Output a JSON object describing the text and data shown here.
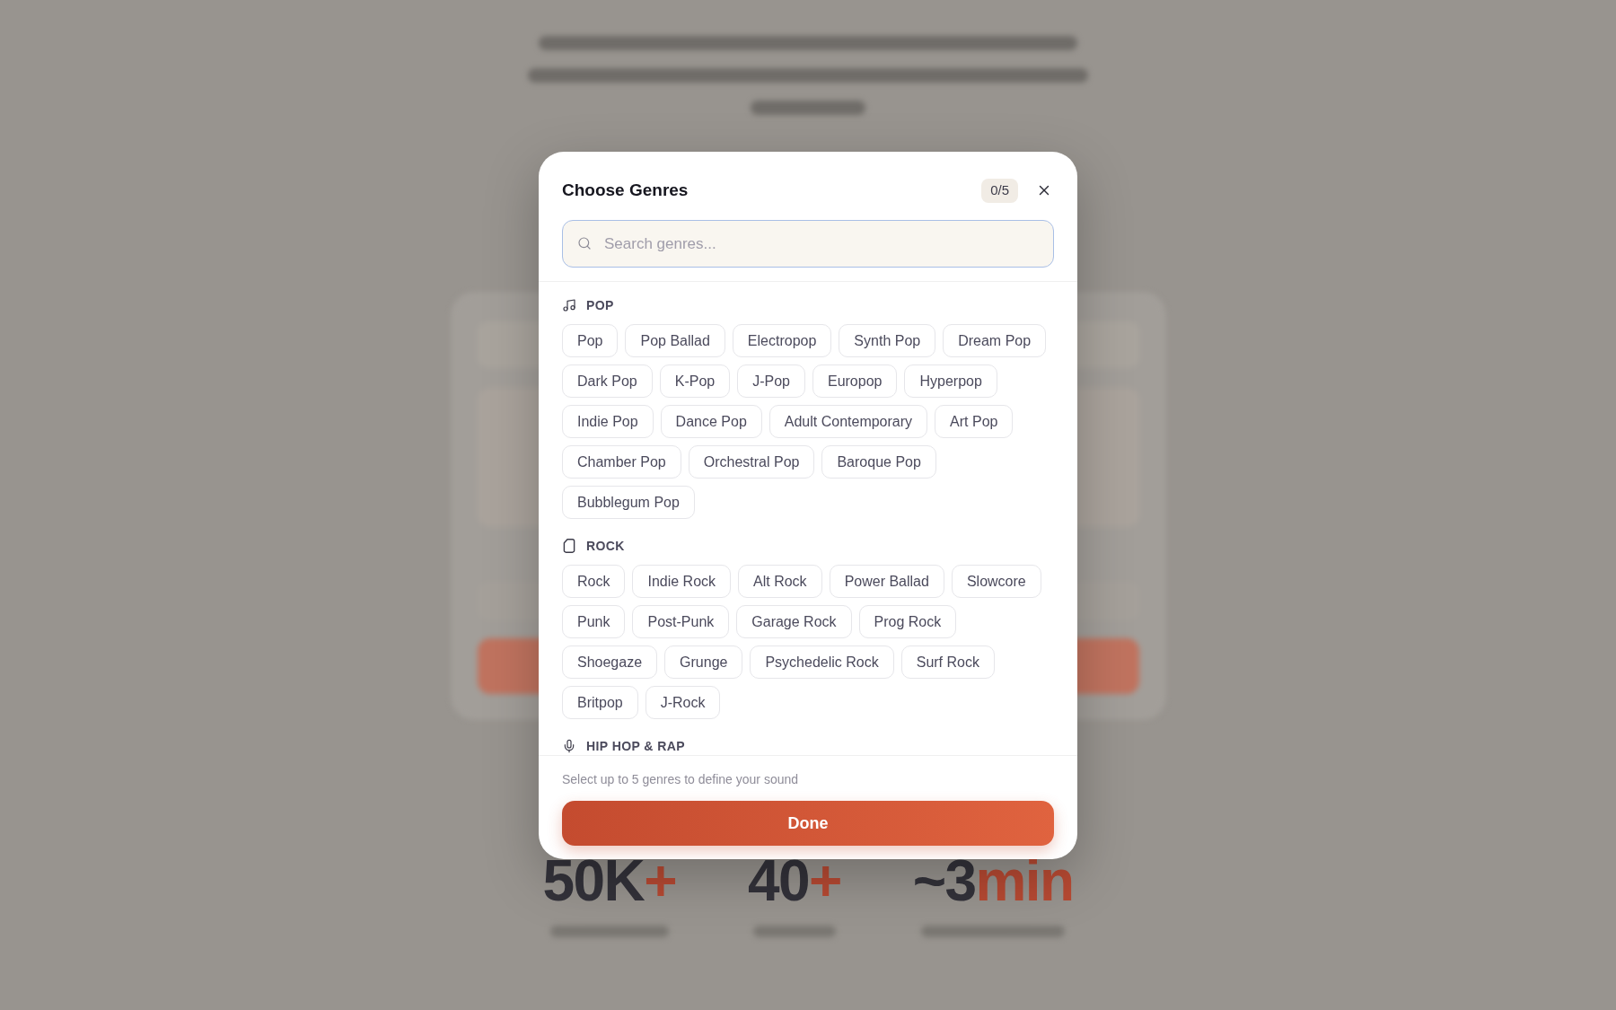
{
  "background": {
    "stats": [
      {
        "value": "50K",
        "suffix": "+"
      },
      {
        "value": "40",
        "suffix": "+"
      },
      {
        "value": "~3",
        "suffix": "min"
      }
    ]
  },
  "dialog": {
    "title": "Choose Genres",
    "counter": "0/5",
    "search": {
      "placeholder": "Search genres..."
    },
    "sections": [
      {
        "title": "POP",
        "genres": [
          {
            "label": "Pop",
            "selected": false
          },
          {
            "label": "Pop Ballad",
            "selected": false
          },
          {
            "label": "Electropop",
            "selected": false
          },
          {
            "label": "Synth Pop",
            "selected": false
          },
          {
            "label": "Dream Pop",
            "selected": false
          },
          {
            "label": "Dark Pop",
            "selected": false
          },
          {
            "label": "K-Pop",
            "selected": false
          },
          {
            "label": "J-Pop",
            "selected": false
          },
          {
            "label": "Europop",
            "selected": false
          },
          {
            "label": "Hyperpop",
            "selected": false
          },
          {
            "label": "Indie Pop",
            "selected": false
          },
          {
            "label": "Dance Pop",
            "selected": false
          },
          {
            "label": "Adult Contemporary",
            "selected": false
          },
          {
            "label": "Art Pop",
            "selected": false
          },
          {
            "label": "Chamber Pop",
            "selected": false
          },
          {
            "label": "Orchestral Pop",
            "selected": false
          },
          {
            "label": "Baroque Pop",
            "selected": false
          },
          {
            "label": "Bubblegum Pop",
            "selected": false
          }
        ]
      },
      {
        "title": "ROCK",
        "genres": [
          {
            "label": "Rock",
            "selected": false
          },
          {
            "label": "Indie Rock",
            "selected": false
          },
          {
            "label": "Alt Rock",
            "selected": false
          },
          {
            "label": "Power Ballad",
            "selected": false
          },
          {
            "label": "Slowcore",
            "selected": false
          },
          {
            "label": "Punk",
            "selected": false
          },
          {
            "label": "Post-Punk",
            "selected": false
          },
          {
            "label": "Garage Rock",
            "selected": false
          },
          {
            "label": "Prog Rock",
            "selected": false
          },
          {
            "label": "Shoegaze",
            "selected": false
          },
          {
            "label": "Grunge",
            "selected": false
          },
          {
            "label": "Psychedelic Rock",
            "selected": false
          },
          {
            "label": "Surf Rock",
            "selected": false
          },
          {
            "label": "Britpop",
            "selected": false
          },
          {
            "label": "J-Rock",
            "selected": false
          }
        ]
      },
      {
        "title": "HIP HOP & RAP"
      }
    ],
    "hint": "Select up to 5 genres to define your sound",
    "done_button": "Done"
  }
}
